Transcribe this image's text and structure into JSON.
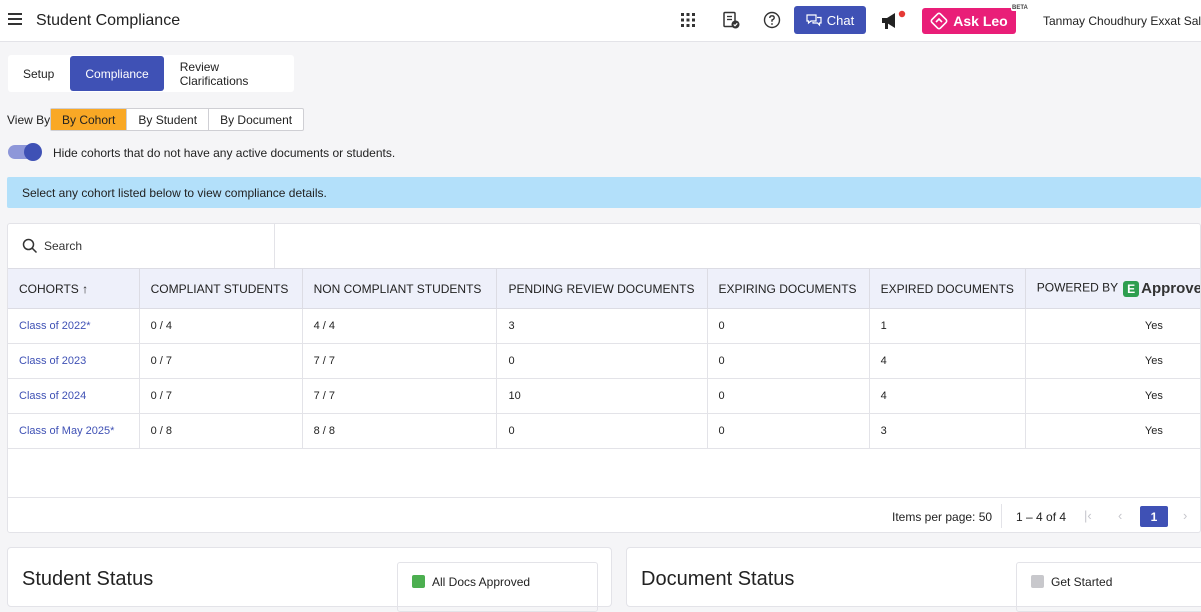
{
  "header": {
    "title": "Student Compliance",
    "chat_label": "Chat",
    "leo_label": "Ask Leo",
    "leo_badge": "BETA",
    "user": "Tanmay Choudhury  Exxat Sale"
  },
  "tabs": [
    "Setup",
    "Compliance",
    "Review Clarifications"
  ],
  "view_by": {
    "label": "View By:",
    "options": [
      "By Cohort",
      "By Student",
      "By Document"
    ],
    "selected": "By Cohort"
  },
  "toggle": {
    "label": "Hide cohorts that do not have any active documents or students.",
    "on": true
  },
  "info": "Select any cohort listed below to view compliance details.",
  "search": {
    "placeholder": "Search"
  },
  "table": {
    "headers": [
      "COHORTS",
      "COMPLIANT STUDENTS",
      "NON COMPLIANT STUDENTS",
      "PENDING REVIEW DOCUMENTS",
      "EXPIRING DOCUMENTS",
      "EXPIRED DOCUMENTS",
      "POWERED BY"
    ],
    "powered_by_logo": "Approve",
    "rows": [
      [
        "Class of 2022*",
        "0 / 4",
        "4 / 4",
        "3",
        "0",
        "1",
        "Yes"
      ],
      [
        "Class of 2023",
        "0 / 7",
        "7 / 7",
        "0",
        "0",
        "4",
        "Yes"
      ],
      [
        "Class of 2024",
        "0 / 7",
        "7 / 7",
        "10",
        "0",
        "4",
        "Yes"
      ],
      [
        "Class of May 2025*",
        "0 / 8",
        "8 / 8",
        "0",
        "0",
        "3",
        "Yes"
      ]
    ]
  },
  "pagination": {
    "items_label": "Items per page: 50",
    "range": "1 – 4 of 4",
    "page": "1"
  },
  "student_status": {
    "title": "Student Status",
    "legend": "All Docs Approved",
    "legend_color": "#4caf50"
  },
  "document_status": {
    "title": "Document Status",
    "legend": "Get Started",
    "legend_color": "#c8c8cc"
  },
  "colors": {
    "primary": "#3f51b5",
    "accent": "#f9a825",
    "leo": "#e91e78",
    "info": "#b3e0fa"
  }
}
